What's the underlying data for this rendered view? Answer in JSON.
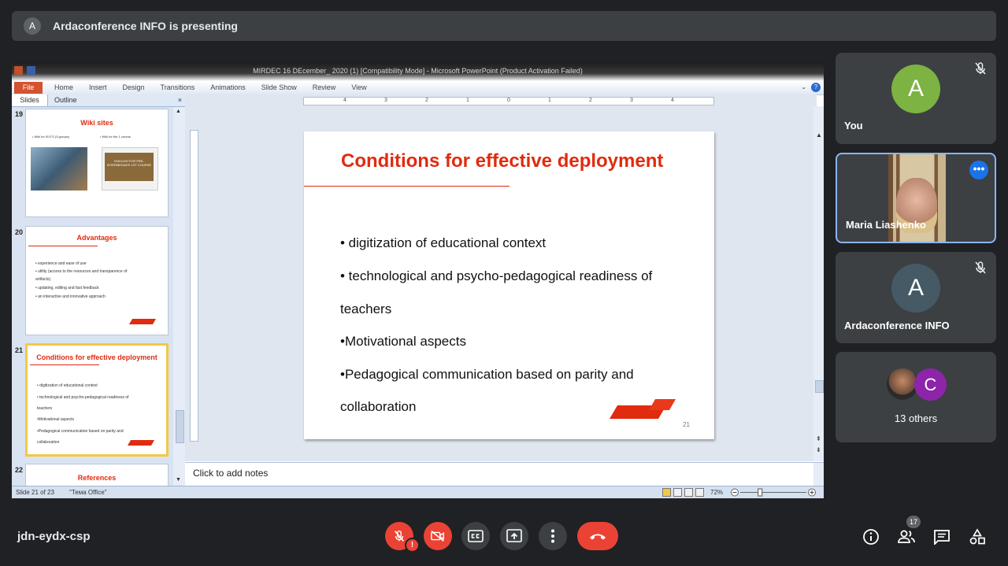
{
  "banner": {
    "avatar_letter": "A",
    "text": "Ardaconference INFO is presenting"
  },
  "ppt": {
    "window_title": "MIRDEC 16 DEcember_ 2020 (1) [Compatibility Mode] - Microsoft PowerPoint (Product Activation Failed)",
    "file_tab": "File",
    "tabs": [
      "Home",
      "Insert",
      "Design",
      "Transitions",
      "Animations",
      "Slide Show",
      "Review",
      "View"
    ],
    "pane_tabs": {
      "slides": "Slides",
      "outline": "Outline",
      "close": "×"
    },
    "thumbs": [
      {
        "num": "19",
        "title": "Wiki sites",
        "bullets": [
          "•   Wiki for IELTS (3 groups)",
          "•   Wiki for the 1 course"
        ],
        "pic_text": "ENGLISH FOR PRE-INTERMEDIATE 1ST COURSE"
      },
      {
        "num": "20",
        "title": "Advantages",
        "bullets": [
          "• experience and ease of use",
          "• utility (access to the resources and transparence of",
          "artifacts)",
          "• updating,  editing and fast feedback",
          "• an interactive and innovative approach"
        ]
      },
      {
        "num": "21",
        "title": "Conditions for effective deployment",
        "bullets": [
          "• digitization of educational context",
          "• technological and psycho-pedagogical readiness of",
          "teachers",
          "•Motivational aspects",
          "•Pedagogical communication based on parity and",
          "collaboration"
        ]
      },
      {
        "num": "22",
        "title": "References"
      }
    ],
    "ruler_marks": [
      "4",
      "3",
      "2",
      "1",
      "0",
      "1",
      "2",
      "3",
      "4"
    ],
    "slide": {
      "title": "Conditions for effective deployment",
      "bullets": [
        "• digitization of educational context",
        "• technological and psycho-pedagogical readiness of",
        "teachers",
        "•Motivational aspects",
        "•Pedagogical communication based on parity and",
        "collaboration"
      ],
      "page_number": "21"
    },
    "notes_placeholder": "Click to add notes",
    "status": {
      "slide_of": "Slide 21 of 23",
      "theme": "\"Тема Office\"",
      "zoom": "72%",
      "zoom_level": 0.3
    }
  },
  "participants": [
    {
      "name": "You",
      "avatar_letter": "A",
      "avatar_color": "#7cb342",
      "muted": true
    },
    {
      "name": "Maria Liashenko",
      "active_speaker": true
    },
    {
      "name": "Ardaconference INFO",
      "avatar_letter": "A",
      "avatar_color": "#455a64",
      "muted": true
    },
    {
      "name": "13 others",
      "avatar_letter": "C",
      "avatar_color": "#8e24aa"
    }
  ],
  "meeting": {
    "code": "jdn-eydx-csp",
    "people_count": "17"
  },
  "colors": {
    "accent_red": "#e02b0f",
    "meet_red": "#ea4335",
    "bg": "#202124"
  }
}
